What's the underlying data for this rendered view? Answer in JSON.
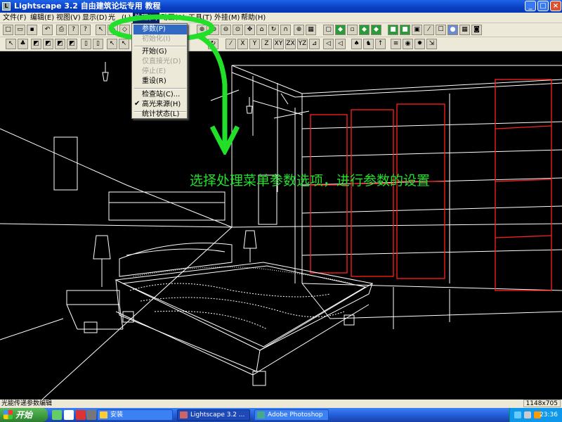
{
  "window": {
    "title": "Lightscape 3.2 自由建筑论坛专用 教程"
  },
  "menu": {
    "file": "文件(F)",
    "edit": "编辑(E)",
    "view": "视图(V)",
    "display": "显示(D)",
    "light": "光",
    "l": "(L)",
    "process": "处理(P)",
    "animation": "动画(A)",
    "tools": "工具(T)",
    "plugins": "外挂(M)",
    "help": "帮助(H)"
  },
  "dropdown": {
    "parameters": "参数(P)",
    "init": "初始化(I)",
    "start": "开始(G)",
    "direct": "仅直接光(D)",
    "stop": "停止(E)",
    "reset": "重设(R)",
    "inspect": "检查站(C)...",
    "highlight": "高光来源(H)",
    "stats": "统计状态(L)"
  },
  "annotation": {
    "text": "选择处理菜单参数选项，进行参数的设置"
  },
  "status": {
    "text": "光能传递参数编辑",
    "dims": "1148x705"
  },
  "taskbar": {
    "start": "开始",
    "folder": "安装",
    "lightscape": "Lightscape 3.2 ...",
    "photoshop": "Adobe Photoshop",
    "clock": "23:36"
  },
  "toolbar2_labels": {
    "x": "X",
    "y": "Y",
    "z": "Z",
    "xy": "XY",
    "zx": "ZX",
    "yz": "YZ"
  },
  "colors": {
    "wireframe": "#ffffff",
    "panel_highlight": "#ff2020",
    "annotation": "#22e02a",
    "menu_selected": "#316ac5"
  }
}
